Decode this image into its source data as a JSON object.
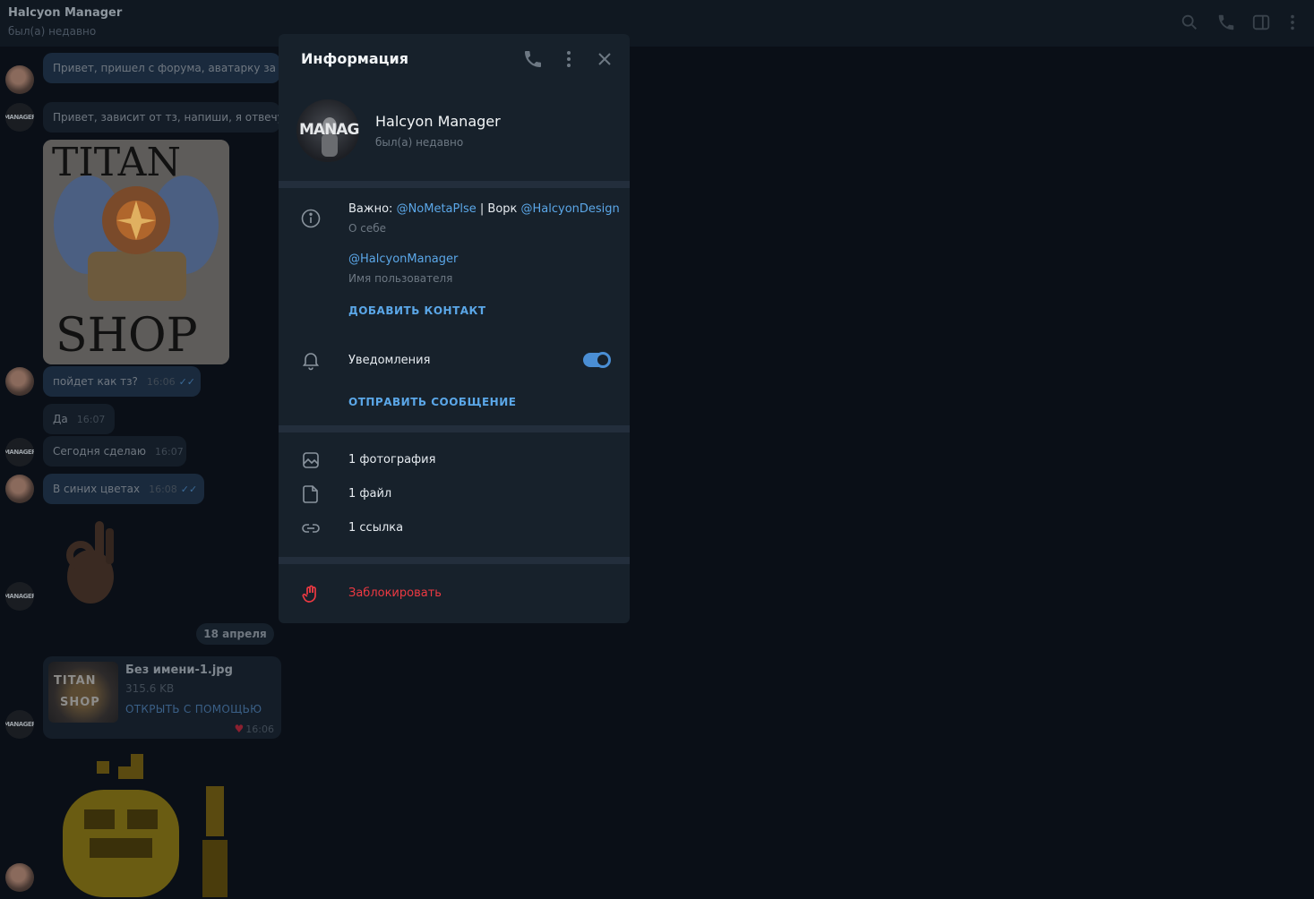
{
  "header": {
    "title": "Halcyon Manager",
    "status": "был(а) недавно"
  },
  "chat": {
    "messages": [
      {
        "text": "Привет, пришел с форума, аватарку за о"
      },
      {
        "text": "Привет, зависит от тз, напиши, я отвечу"
      },
      {
        "text": "пойдет как тз?",
        "time": "16:06"
      },
      {
        "text": "Да",
        "time": "16:07"
      },
      {
        "text": "Сегодня сделаю",
        "time": "16:07"
      },
      {
        "text": "В синих цветах",
        "time": "16:08"
      }
    ],
    "sticker_titan": {
      "top": "TITAN",
      "bottom": "SHOP"
    },
    "date_divider": "18 апреля",
    "file": {
      "name": "Без имени-1.jpg",
      "size": "315.6 KB",
      "open_label": "ОТКРЫТЬ С ПОМОЩЬЮ",
      "time": "16:06",
      "thumb_top": "TITAN",
      "thumb_bottom": "SHOP"
    },
    "avatar_label": "MANAGER"
  },
  "panel": {
    "title": "Информация",
    "name": "Halcyon Manager",
    "status": "был(а) недавно",
    "avatar_label": "MANAGER",
    "bio_prefix": "Важно: ",
    "bio_link1": "@NoMetaPlse",
    "bio_mid": " | Ворк ",
    "bio_link2": "@HalcyonDesign",
    "bio_caption": "О себе",
    "username": "@HalcyonManager",
    "username_caption": "Имя пользователя",
    "add_contact": "ДОБАВИТЬ КОНТАКТ",
    "notifications_label": "Уведомления",
    "notifications_on": true,
    "send_message": "ОТПРАВИТЬ СООБЩЕНИЕ",
    "media": [
      {
        "label": "1 фотография",
        "icon": "photo-icon"
      },
      {
        "label": "1 файл",
        "icon": "file-icon"
      },
      {
        "label": "1 ссылка",
        "icon": "link-icon"
      }
    ],
    "block_label": "Заблокировать"
  },
  "colors": {
    "accent": "#5ba7e8",
    "danger": "#ec3942",
    "panel_bg": "#17212b"
  }
}
